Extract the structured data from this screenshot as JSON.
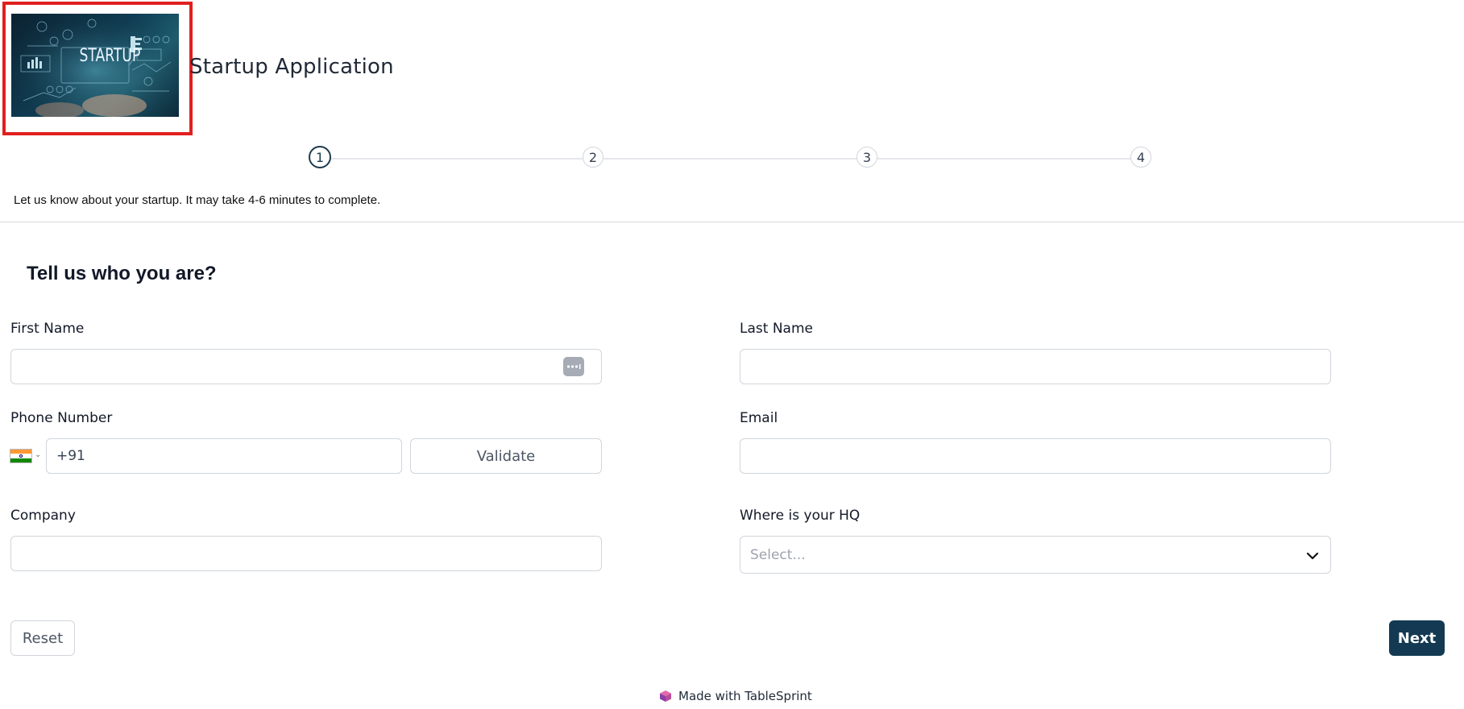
{
  "header": {
    "logo_text": "STARTUP",
    "title": "Startup Application"
  },
  "stepper": {
    "steps": [
      "1",
      "2",
      "3",
      "4"
    ],
    "active": 1
  },
  "intro_text": "Let us know about your startup. It may take 4-6 minutes to complete.",
  "section": {
    "title": "Tell us who you are?"
  },
  "form": {
    "first_name": {
      "label": "First Name",
      "value": ""
    },
    "last_name": {
      "label": "Last Name",
      "value": ""
    },
    "phone": {
      "label": "Phone Number",
      "country": "India",
      "dial_code": "+91",
      "validate_label": "Validate"
    },
    "email": {
      "label": "Email",
      "value": ""
    },
    "company": {
      "label": "Company",
      "value": ""
    },
    "hq": {
      "label": "Where is your HQ",
      "placeholder": "Select..."
    }
  },
  "actions": {
    "reset_label": "Reset",
    "next_label": "Next"
  },
  "footer": {
    "text": "Made with TableSprint"
  },
  "colors": {
    "primary": "#133a52",
    "logo_border": "#e0201f",
    "border": "#d1d5db"
  }
}
